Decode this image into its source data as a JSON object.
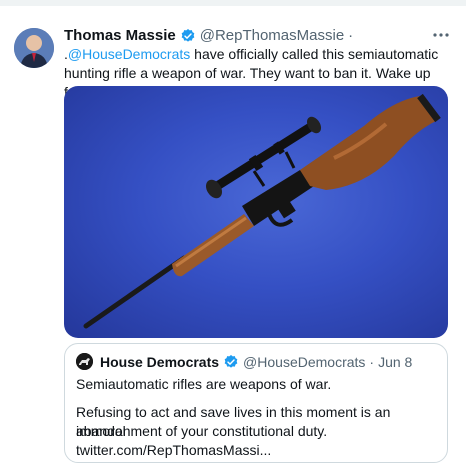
{
  "colors": {
    "link": "#1d9bf0",
    "muted": "#536471",
    "text": "#0f1419",
    "verified": "#1d9bf0",
    "media_background": "#3550c4"
  },
  "tweet": {
    "author_name": "Thomas Massie",
    "author_handle": "@RepThomasMassie",
    "dot": "·",
    "more_icon": "more-horizontal-icon",
    "verified_icon": "verified-badge-icon",
    "text_prefix": ".",
    "mention": "@HouseDemocrats",
    "text_rest": " have officially called this semiautomatic hunting rifle a weapon of war. They want to ban it. Wake up folks before it’s too late."
  },
  "media": {
    "subject": "rifle-image"
  },
  "quote": {
    "author_name": "House Democrats",
    "author_handle": "@HouseDemocrats",
    "separator": "·",
    "date": "Jun 8",
    "line1": "Semiautomatic rifles are weapons of war.",
    "line2": "Refusing to act and save lives in this moment is an immoral",
    "line3": "abandonment of your constitutional duty.",
    "line4": "twitter.com/RepThomasMassi..."
  }
}
